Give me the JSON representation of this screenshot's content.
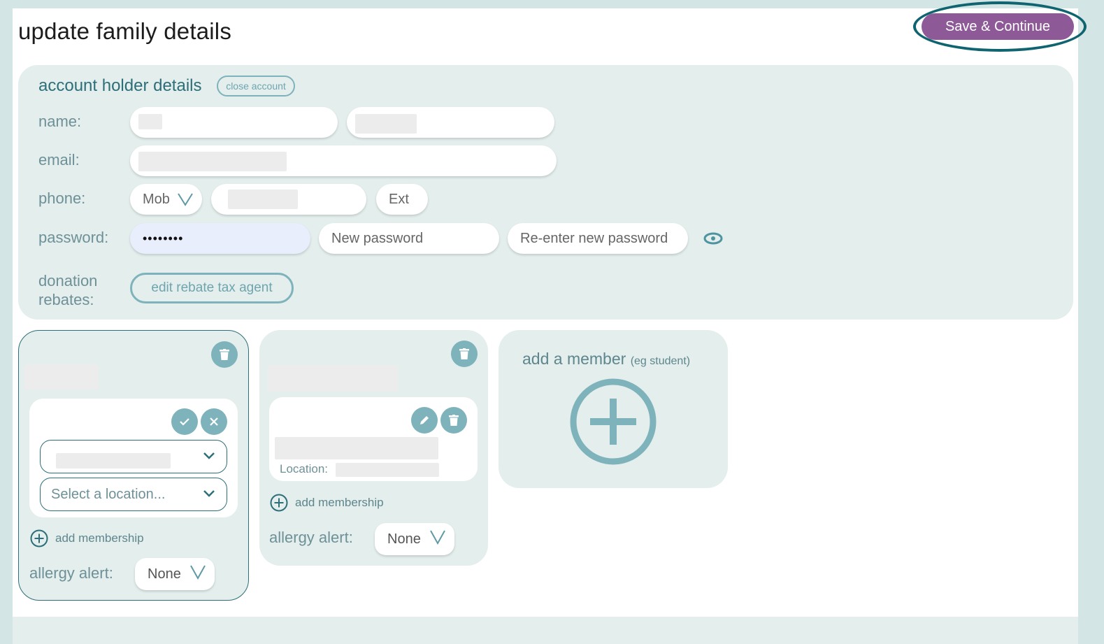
{
  "header": {
    "title": "update family details",
    "save_label": "Save & Continue"
  },
  "account": {
    "section_title": "account holder details",
    "close_label": "close account",
    "labels": {
      "name": "name:",
      "email": "email:",
      "phone": "phone:",
      "password": "password:",
      "donation_line1": "donation",
      "donation_line2": "rebates:"
    },
    "phone_type": "Mob",
    "ext_placeholder": "Ext",
    "password_value": "••••••••",
    "new_password_placeholder": "New password",
    "reenter_password_placeholder": "Re-enter new password",
    "rebate_button": "edit rebate tax agent"
  },
  "members": [
    {
      "select_location_placeholder": "Select a location...",
      "add_membership": "add membership",
      "allergy_label": "allergy alert:",
      "allergy_value": "None"
    },
    {
      "location_label": "Location:",
      "add_membership": "add membership",
      "allergy_label": "allergy alert:",
      "allergy_value": "None"
    }
  ],
  "add_member": {
    "title": "add a member",
    "hint": "(eg student)"
  },
  "colors": {
    "accent": "#2d6f79",
    "button_purple": "#8d5a97",
    "panel_bg": "#e3eeed",
    "icon_teal": "#7fb3bc"
  }
}
